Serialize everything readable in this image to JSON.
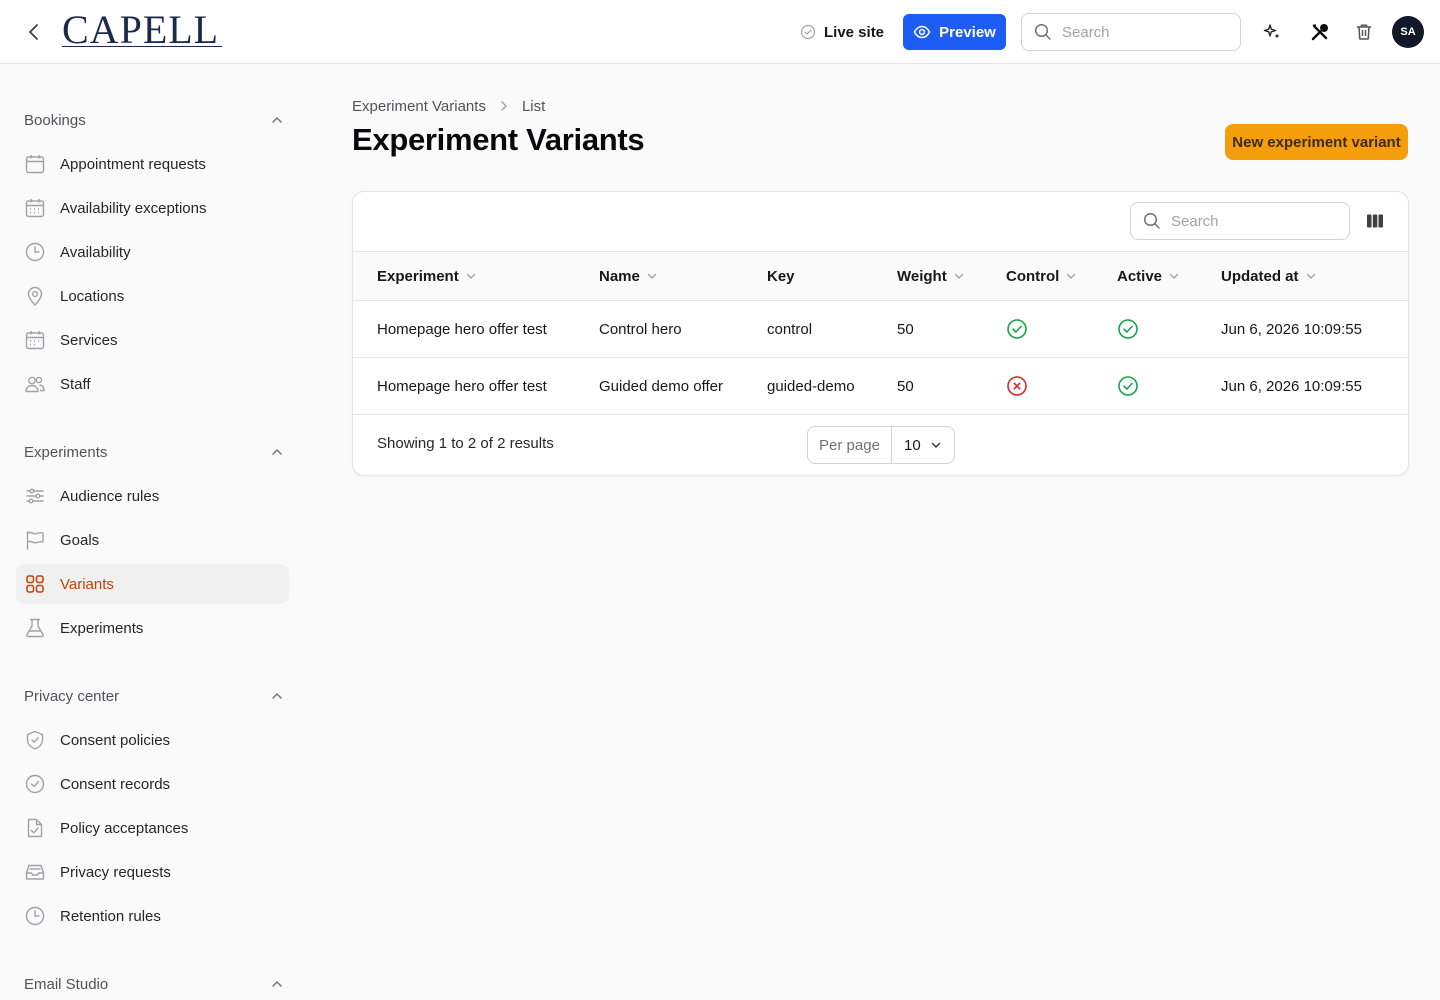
{
  "topbar": {
    "logo": "CAPELL",
    "live_site": "Live site",
    "preview": "Preview",
    "search_placeholder": "Search",
    "avatar": "SA"
  },
  "sidebar": {
    "groups": [
      {
        "label": "Bookings",
        "items": [
          "Appointment requests",
          "Availability exceptions",
          "Availability",
          "Locations",
          "Services",
          "Staff"
        ]
      },
      {
        "label": "Experiments",
        "items": [
          "Audience rules",
          "Goals",
          "Variants",
          "Experiments"
        ]
      },
      {
        "label": "Privacy center",
        "items": [
          "Consent policies",
          "Consent records",
          "Policy acceptances",
          "Privacy requests",
          "Retention rules"
        ]
      },
      {
        "label": "Email Studio",
        "items": []
      }
    ],
    "active_item": "Variants"
  },
  "breadcrumb": [
    "Experiment Variants",
    "List"
  ],
  "page": {
    "title": "Experiment Variants",
    "new_button": "New experiment variant"
  },
  "table": {
    "search_placeholder": "Search",
    "columns": [
      "Experiment",
      "Name",
      "Key",
      "Weight",
      "Control",
      "Active",
      "Updated at"
    ],
    "rows": [
      {
        "experiment": "Homepage hero offer test",
        "name": "Control hero",
        "key": "control",
        "weight": "50",
        "control": true,
        "active": true,
        "updated_at": "Jun 6, 2026 10:09:55"
      },
      {
        "experiment": "Homepage hero offer test",
        "name": "Guided demo offer",
        "key": "guided-demo",
        "weight": "50",
        "control": false,
        "active": true,
        "updated_at": "Jun 6, 2026 10:09:55"
      }
    ],
    "footer": "Showing 1 to 2 of 2 results",
    "per_page_label": "Per page",
    "per_page_value": "10"
  },
  "colors": {
    "accent": "#f59e0b",
    "primary": "#1d5cf5",
    "active_nav": "#c2410c",
    "success": "#16a34a",
    "danger": "#dc2626"
  }
}
